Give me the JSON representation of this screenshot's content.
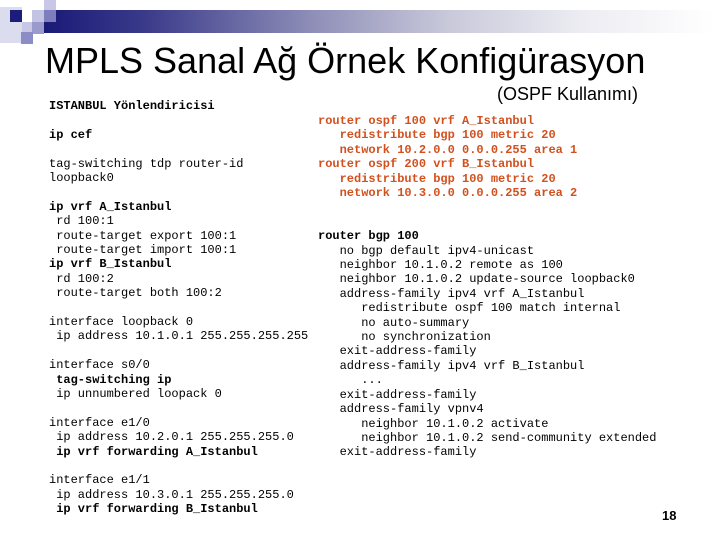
{
  "slide": {
    "title": "MPLS Sanal Ağ Örnek Konfigürasyon",
    "subtitle": "(OSPF Kullanımı)",
    "page_number": "18",
    "colors": {
      "ospf_highlight": "#d2501e",
      "header_bar": "#1a1a78",
      "text": "#000000"
    }
  },
  "left_config": {
    "lines": [
      {
        "text": "ISTANBUL Yönlendiricisi",
        "style": "bold"
      },
      {
        "text": "",
        "style": "normal"
      },
      {
        "text": "ip cef",
        "style": "bold"
      },
      {
        "text": "",
        "style": "normal"
      },
      {
        "text": "tag-switching tdp router-id",
        "style": "normal"
      },
      {
        "text": "loopback0",
        "style": "normal"
      },
      {
        "text": "",
        "style": "normal"
      },
      {
        "text": "ip vrf A_Istanbul",
        "style": "bold"
      },
      {
        "text": " rd 100:1",
        "style": "normal"
      },
      {
        "text": " route-target export 100:1",
        "style": "normal"
      },
      {
        "text": " route-target import 100:1",
        "style": "normal"
      },
      {
        "text": "ip vrf B_Istanbul",
        "style": "bold"
      },
      {
        "text": " rd 100:2",
        "style": "normal"
      },
      {
        "text": " route-target both 100:2",
        "style": "normal"
      },
      {
        "text": "",
        "style": "normal"
      },
      {
        "text": "interface loopback 0",
        "style": "normal"
      },
      {
        "text": " ip address 10.1.0.1 255.255.255.255",
        "style": "normal"
      },
      {
        "text": "",
        "style": "normal"
      },
      {
        "text": "interface s0/0",
        "style": "normal"
      },
      {
        "text": " tag-switching ip",
        "style": "bold"
      },
      {
        "text": " ip unnumbered loopack 0",
        "style": "normal"
      },
      {
        "text": "",
        "style": "normal"
      },
      {
        "text": "interface e1/0",
        "style": "normal"
      },
      {
        "text": " ip address 10.2.0.1 255.255.255.0",
        "style": "normal"
      },
      {
        "text": " ip vrf forwarding A_Istanbul",
        "style": "bold"
      },
      {
        "text": "",
        "style": "normal"
      },
      {
        "text": "interface e1/1",
        "style": "normal"
      },
      {
        "text": " ip address 10.3.0.1 255.255.255.0",
        "style": "normal"
      },
      {
        "text": " ip vrf forwarding B_Istanbul",
        "style": "bold"
      }
    ]
  },
  "right_config": {
    "lines": [
      {
        "text": "router ospf 100 vrf A_Istanbul",
        "style": "orange"
      },
      {
        "text": "   redistribute bgp 100 metric 20",
        "style": "orange"
      },
      {
        "text": "   network 10.2.0.0 0.0.0.255 area 1",
        "style": "orange"
      },
      {
        "text": "router ospf 200 vrf B_Istanbul",
        "style": "orange"
      },
      {
        "text": "   redistribute bgp 100 metric 20",
        "style": "orange"
      },
      {
        "text": "   network 10.3.0.0 0.0.0.255 area 2",
        "style": "orange"
      },
      {
        "text": "",
        "style": "normal"
      },
      {
        "text": "",
        "style": "normal"
      },
      {
        "text": "router bgp 100",
        "style": "bold"
      },
      {
        "text": "   no bgp default ipv4-unicast",
        "style": "normal"
      },
      {
        "text": "   neighbor 10.1.0.2 remote as 100",
        "style": "normal"
      },
      {
        "text": "   neighbor 10.1.0.2 update-source loopback0",
        "style": "normal"
      },
      {
        "text": "   address-family ipv4 vrf A_Istanbul",
        "style": "normal"
      },
      {
        "text": "      redistribute ospf 100 match internal",
        "style": "normal"
      },
      {
        "text": "      no auto-summary",
        "style": "normal"
      },
      {
        "text": "      no synchronization",
        "style": "normal"
      },
      {
        "text": "   exit-address-family",
        "style": "normal"
      },
      {
        "text": "   address-family ipv4 vrf B_Istanbul",
        "style": "normal"
      },
      {
        "text": "      ...",
        "style": "normal"
      },
      {
        "text": "   exit-address-family",
        "style": "normal"
      },
      {
        "text": "   address-family vpnv4",
        "style": "normal"
      },
      {
        "text": "      neighbor 10.1.0.2 activate",
        "style": "normal"
      },
      {
        "text": "      neighbor 10.1.0.2 send-community extended",
        "style": "normal"
      },
      {
        "text": "   exit-address-family",
        "style": "normal"
      }
    ]
  }
}
